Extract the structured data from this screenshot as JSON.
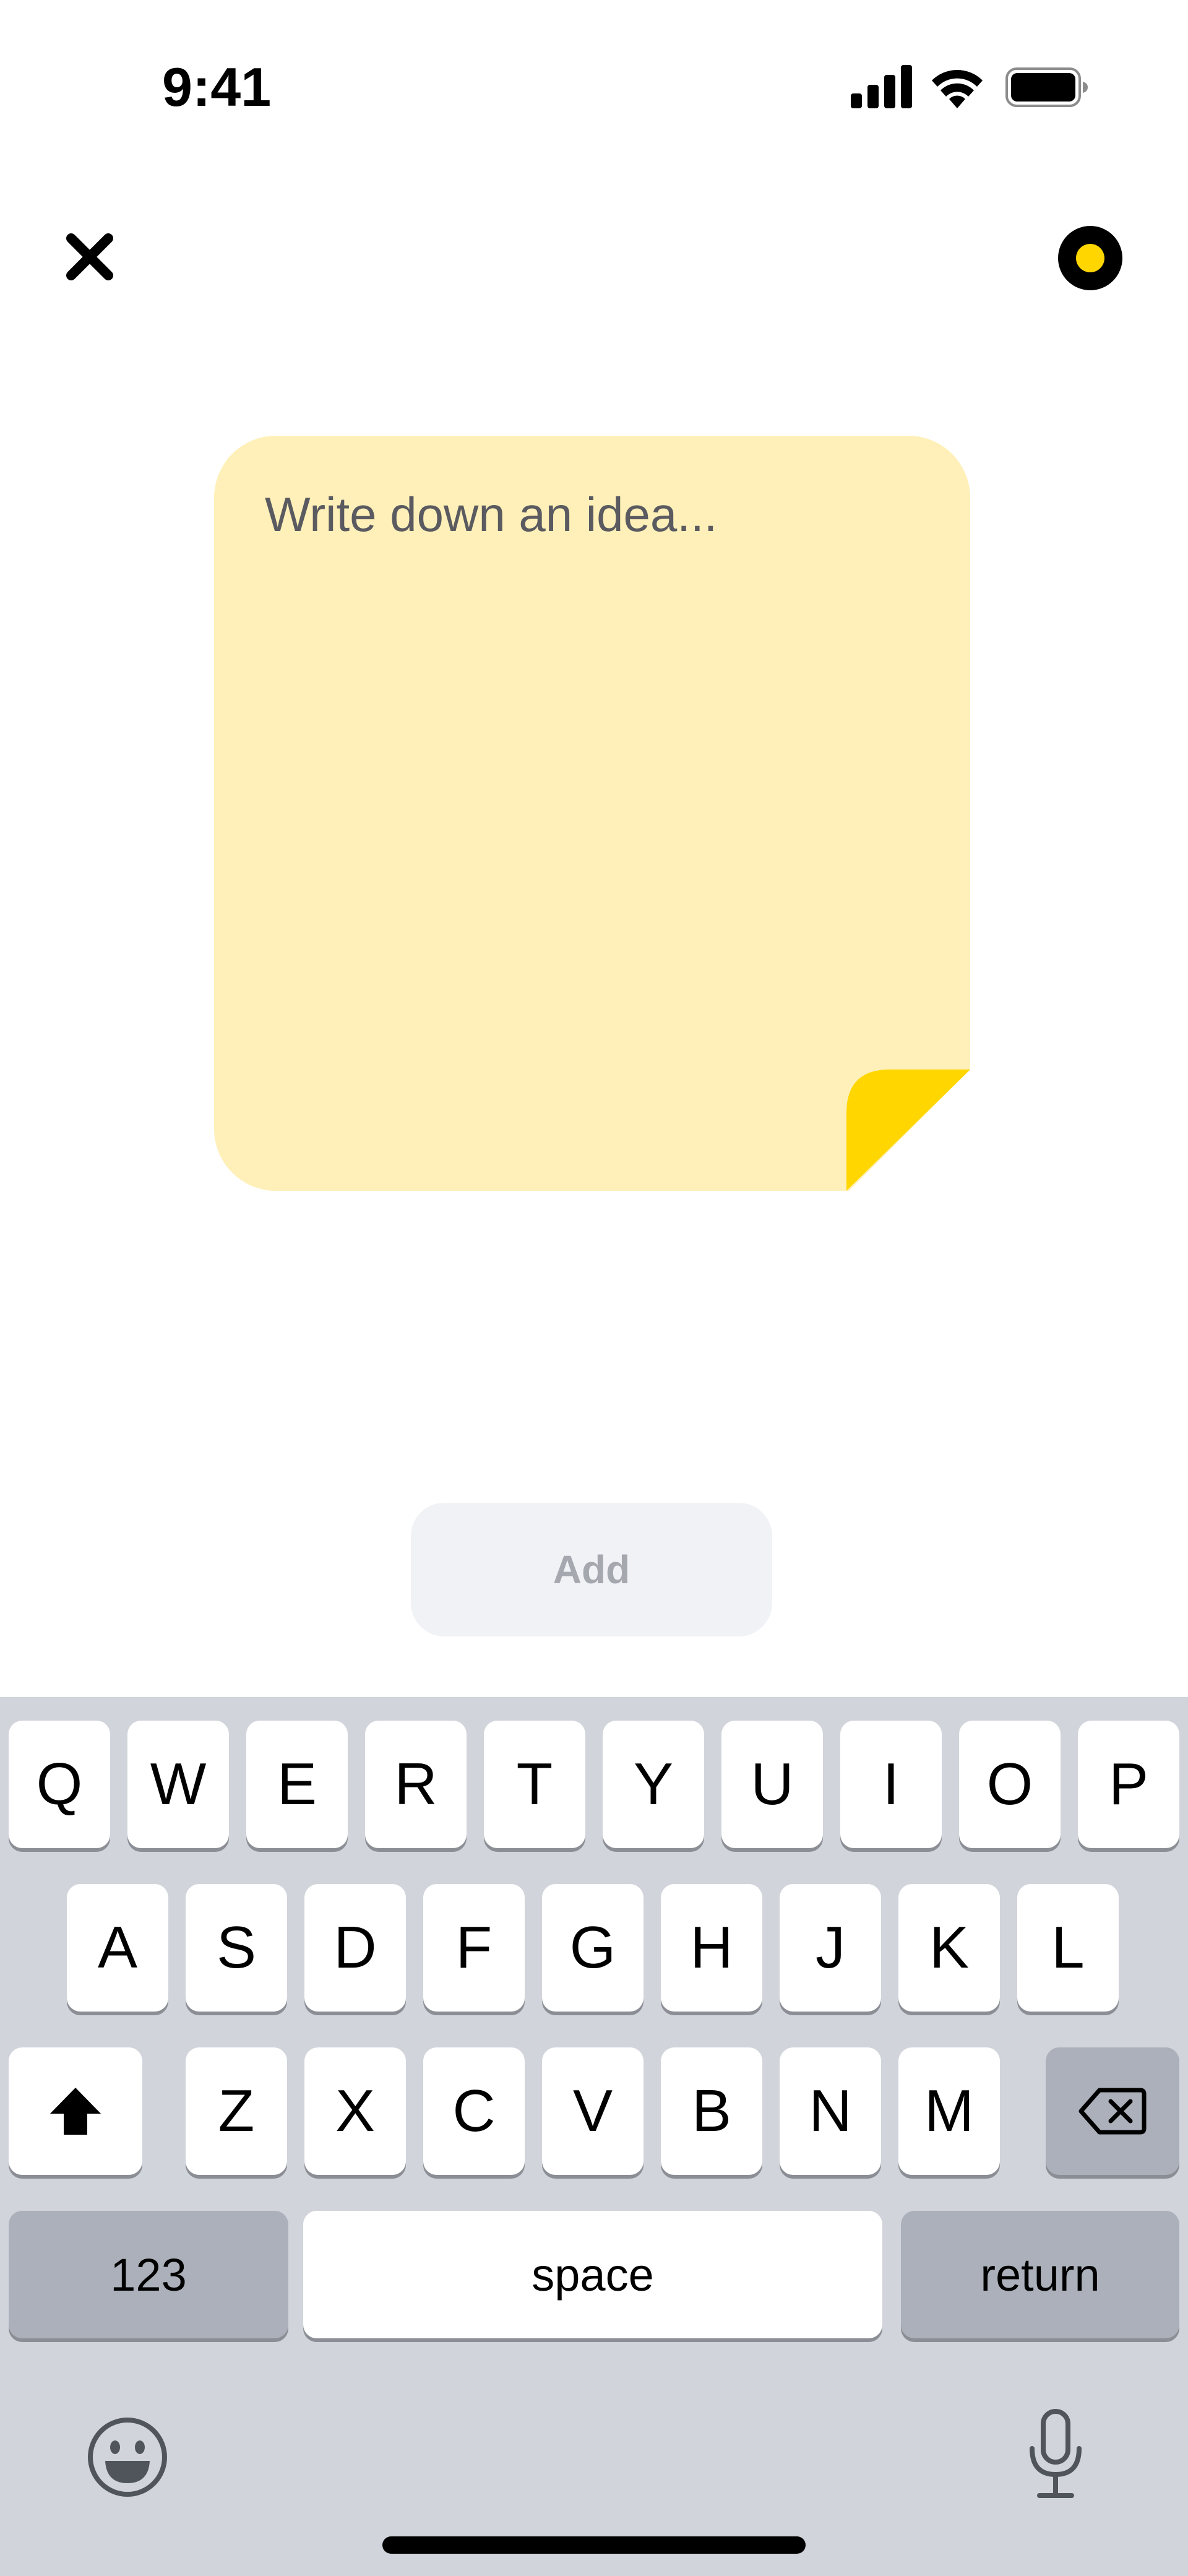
{
  "status_bar": {
    "time": "9:41",
    "signal_icon": "cellular-signal-icon",
    "wifi_icon": "wifi-icon",
    "battery_icon": "battery-icon"
  },
  "top_bar": {
    "close_icon": "close-icon",
    "color_picker_icon": "color-dot-icon",
    "selected_color": "#FFD600"
  },
  "note": {
    "placeholder": "Write down an idea...",
    "value": "",
    "background_color": "#FEF0B8",
    "fold_color": "#FFD600"
  },
  "add_button": {
    "label": "Add",
    "enabled": false
  },
  "keyboard": {
    "row1": [
      "Q",
      "W",
      "E",
      "R",
      "T",
      "Y",
      "U",
      "I",
      "O",
      "P"
    ],
    "row2": [
      "A",
      "S",
      "D",
      "F",
      "G",
      "H",
      "J",
      "K",
      "L"
    ],
    "row3": [
      "Z",
      "X",
      "C",
      "V",
      "B",
      "N",
      "M"
    ],
    "shift_icon": "shift-icon",
    "delete_icon": "backspace-icon",
    "numbers_label": "123",
    "space_label": "space",
    "return_label": "return",
    "emoji_icon": "emoji-icon",
    "mic_icon": "microphone-icon"
  }
}
